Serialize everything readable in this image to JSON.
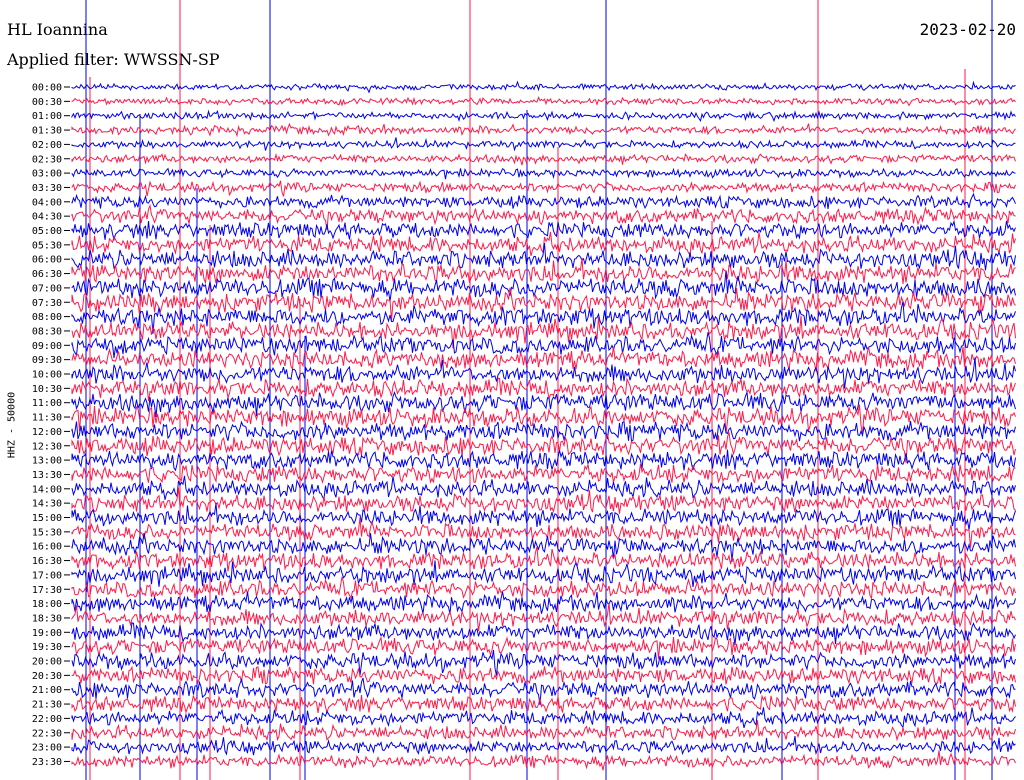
{
  "header": {
    "station": "HL Ioannina",
    "filter": "Applied filter: WWSSN-SP",
    "date": "2023-02-20"
  },
  "chart_data": {
    "type": "line",
    "ylabel": "HHZ - 50000",
    "y_tick_labels": [
      "00:00",
      "00:30",
      "01:00",
      "01:30",
      "02:00",
      "02:30",
      "03:00",
      "03:30",
      "04:00",
      "04:30",
      "05:00",
      "05:30",
      "06:00",
      "06:30",
      "07:00",
      "07:30",
      "08:00",
      "08:30",
      "09:00",
      "09:30",
      "10:00",
      "10:30",
      "11:00",
      "11:30",
      "12:00",
      "12:30",
      "13:00",
      "13:30",
      "14:00",
      "14:30",
      "15:00",
      "15:30",
      "16:00",
      "16:30",
      "17:00",
      "17:30",
      "18:00",
      "18:30",
      "19:00",
      "19:30",
      "20:00",
      "20:30",
      "21:00",
      "21:30",
      "22:00",
      "22:30",
      "23:00",
      "23:30"
    ],
    "trace_colors": [
      "#0000ee",
      "#ff1a4a"
    ],
    "activity": [
      0.15,
      0.18,
      0.22,
      0.3,
      0.25,
      0.3,
      0.28,
      0.4,
      0.55,
      0.7,
      0.8,
      0.85,
      0.9,
      0.95,
      1.0,
      0.95,
      0.95,
      0.9,
      0.9,
      0.9,
      0.9,
      0.9,
      0.95,
      0.95,
      0.95,
      0.95,
      0.9,
      0.9,
      0.85,
      0.85,
      0.85,
      0.8,
      0.85,
      0.85,
      0.85,
      0.85,
      0.8,
      0.8,
      0.8,
      0.8,
      0.8,
      0.8,
      0.8,
      0.75,
      0.7,
      0.65,
      0.6,
      0.55
    ]
  }
}
